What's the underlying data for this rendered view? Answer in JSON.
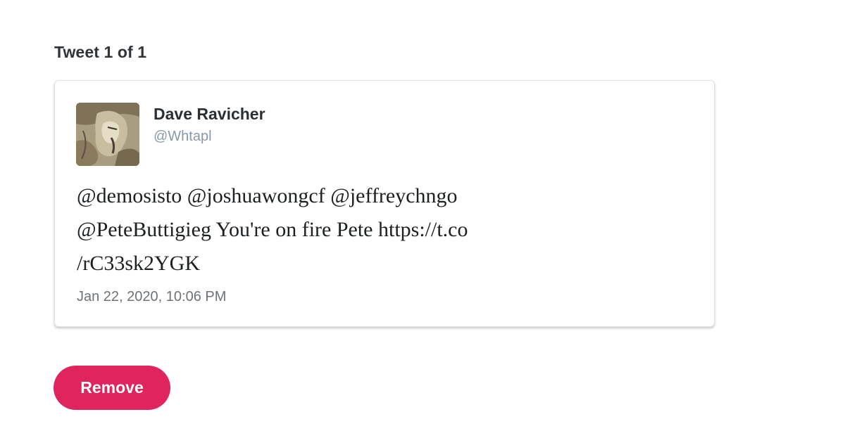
{
  "heading": "Tweet 1 of 1",
  "tweet": {
    "author_name": "Dave Ravicher",
    "author_handle": "@Whtapl",
    "text_lines": [
      "@demosisto @joshuawongcf @jeffreychngo",
      "@PeteButtigieg You're on fire Pete https://t.co",
      "/rC33sk2YGK"
    ],
    "date": "Jan 22, 2020, 10:06 PM",
    "avatar_icon": "profile-photo"
  },
  "actions": {
    "remove_label": "Remove"
  },
  "colors": {
    "remove_button": "#e0245e",
    "handle_text": "#8899a6"
  }
}
